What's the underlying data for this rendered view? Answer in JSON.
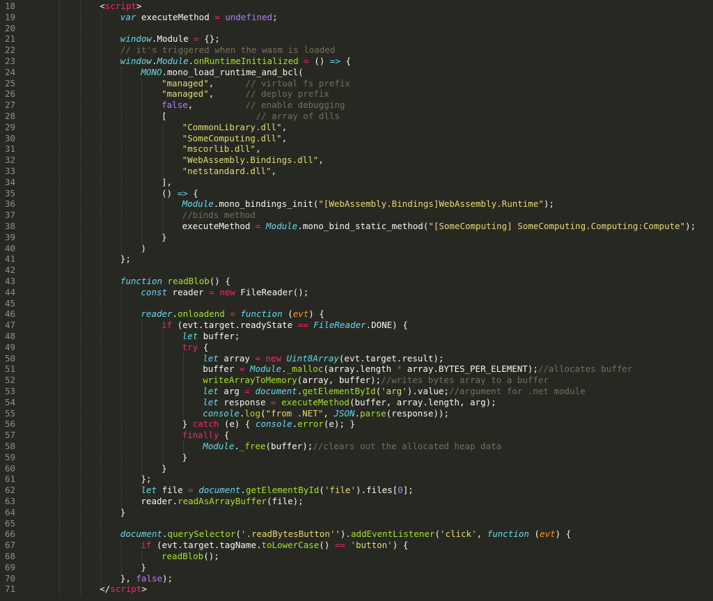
{
  "editor": {
    "theme": "monokai",
    "colors": {
      "background": "#272822",
      "foreground": "#f8f8f2",
      "line_number": "#90908a",
      "keyword": "#f92672",
      "string": "#e6db74",
      "comment": "#75715e",
      "constant": "#ae81ff",
      "function": "#a6e22e",
      "storage": "#66d9ef",
      "parameter": "#fd971f"
    },
    "lines": [
      {
        "num": "18",
        "indent": 2,
        "tokens": [
          [
            "t",
            "<"
          ],
          [
            "k",
            "script"
          ],
          [
            "t",
            ">"
          ]
        ]
      },
      {
        "num": "19",
        "indent": 3,
        "tokens": [
          [
            "i",
            "var"
          ],
          [
            "t",
            " executeMethod "
          ],
          [
            "k",
            "="
          ],
          [
            "t",
            " "
          ],
          [
            "n",
            "undefined"
          ],
          [
            "t",
            ";"
          ]
        ]
      },
      {
        "num": "20",
        "indent": 0,
        "tokens": []
      },
      {
        "num": "21",
        "indent": 3,
        "tokens": [
          [
            "i",
            "window"
          ],
          [
            "t",
            ".Module "
          ],
          [
            "k",
            "="
          ],
          [
            "t",
            " {};"
          ]
        ]
      },
      {
        "num": "22",
        "indent": 3,
        "tokens": [
          [
            "c",
            "// it's triggered when the wasm is loaded"
          ]
        ]
      },
      {
        "num": "23",
        "indent": 3,
        "tokens": [
          [
            "i",
            "window"
          ],
          [
            "t",
            "."
          ],
          [
            "i",
            "Module"
          ],
          [
            "t",
            "."
          ],
          [
            "f",
            "onRuntimeInitialized"
          ],
          [
            "t",
            " "
          ],
          [
            "k",
            "="
          ],
          [
            "t",
            " () "
          ],
          [
            "i",
            "=>"
          ],
          [
            "t",
            " {"
          ]
        ]
      },
      {
        "num": "24",
        "indent": 4,
        "tokens": [
          [
            "i",
            "MONO"
          ],
          [
            "t",
            ".mono_load_runtime_and_bcl("
          ]
        ]
      },
      {
        "num": "25",
        "indent": 5,
        "tokens": [
          [
            "s",
            "\"managed\""
          ],
          [
            "t",
            ",      "
          ],
          [
            "c",
            "// virtual fs prefix"
          ]
        ]
      },
      {
        "num": "26",
        "indent": 5,
        "tokens": [
          [
            "s",
            "\"managed\""
          ],
          [
            "t",
            ",      "
          ],
          [
            "c",
            "// deploy prefix"
          ]
        ]
      },
      {
        "num": "27",
        "indent": 5,
        "tokens": [
          [
            "n",
            "false"
          ],
          [
            "t",
            ",          "
          ],
          [
            "c",
            "// enable debugging"
          ]
        ]
      },
      {
        "num": "28",
        "indent": 5,
        "tokens": [
          [
            "t",
            "[                 "
          ],
          [
            "c",
            "// array of dlls"
          ]
        ]
      },
      {
        "num": "29",
        "indent": 6,
        "tokens": [
          [
            "s",
            "\"CommonLibrary.dll\""
          ],
          [
            "t",
            ","
          ]
        ]
      },
      {
        "num": "30",
        "indent": 6,
        "tokens": [
          [
            "s",
            "\"SomeComputing.dll\""
          ],
          [
            "t",
            ","
          ]
        ]
      },
      {
        "num": "31",
        "indent": 6,
        "tokens": [
          [
            "s",
            "\"mscorlib.dll\""
          ],
          [
            "t",
            ","
          ]
        ]
      },
      {
        "num": "32",
        "indent": 6,
        "tokens": [
          [
            "s",
            "\"WebAssembly.Bindings.dll\""
          ],
          [
            "t",
            ","
          ]
        ]
      },
      {
        "num": "33",
        "indent": 6,
        "tokens": [
          [
            "s",
            "\"netstandard.dll\""
          ],
          [
            "t",
            ","
          ]
        ]
      },
      {
        "num": "34",
        "indent": 5,
        "tokens": [
          [
            "t",
            "],"
          ]
        ]
      },
      {
        "num": "35",
        "indent": 5,
        "tokens": [
          [
            "t",
            "() "
          ],
          [
            "i",
            "=>"
          ],
          [
            "t",
            " {"
          ]
        ]
      },
      {
        "num": "36",
        "indent": 6,
        "tokens": [
          [
            "i",
            "Module"
          ],
          [
            "t",
            ".mono_bindings_init("
          ],
          [
            "s",
            "\"[WebAssembly.Bindings]WebAssembly.Runtime\""
          ],
          [
            "t",
            ");"
          ]
        ]
      },
      {
        "num": "37",
        "indent": 6,
        "tokens": [
          [
            "c",
            "//binds method"
          ]
        ]
      },
      {
        "num": "38",
        "indent": 6,
        "tokens": [
          [
            "t",
            "executeMethod "
          ],
          [
            "k",
            "="
          ],
          [
            "t",
            " "
          ],
          [
            "i",
            "Module"
          ],
          [
            "t",
            ".mono_bind_static_method("
          ],
          [
            "s",
            "\"[SomeComputing] SomeComputing.Computing:Compute\""
          ],
          [
            "t",
            ");"
          ]
        ]
      },
      {
        "num": "39",
        "indent": 5,
        "tokens": [
          [
            "t",
            "}"
          ]
        ]
      },
      {
        "num": "40",
        "indent": 4,
        "tokens": [
          [
            "t",
            ")"
          ]
        ]
      },
      {
        "num": "41",
        "indent": 3,
        "tokens": [
          [
            "t",
            "};"
          ]
        ]
      },
      {
        "num": "42",
        "indent": 0,
        "tokens": []
      },
      {
        "num": "43",
        "indent": 3,
        "tokens": [
          [
            "i",
            "function"
          ],
          [
            "t",
            " "
          ],
          [
            "f",
            "readBlob"
          ],
          [
            "t",
            "() {"
          ]
        ]
      },
      {
        "num": "44",
        "indent": 4,
        "tokens": [
          [
            "i",
            "const"
          ],
          [
            "t",
            " reader "
          ],
          [
            "k",
            "="
          ],
          [
            "t",
            " "
          ],
          [
            "k",
            "new"
          ],
          [
            "t",
            " FileReader();"
          ]
        ]
      },
      {
        "num": "45",
        "indent": 0,
        "tokens": []
      },
      {
        "num": "46",
        "indent": 4,
        "tokens": [
          [
            "i",
            "reader"
          ],
          [
            "t",
            "."
          ],
          [
            "f",
            "onloadend"
          ],
          [
            "t",
            " "
          ],
          [
            "k",
            "="
          ],
          [
            "t",
            " "
          ],
          [
            "i",
            "function"
          ],
          [
            "t",
            " ("
          ],
          [
            "p",
            "evt"
          ],
          [
            "t",
            ") {"
          ]
        ]
      },
      {
        "num": "47",
        "indent": 5,
        "tokens": [
          [
            "k",
            "if"
          ],
          [
            "t",
            " (evt.target.readyState "
          ],
          [
            "k",
            "=="
          ],
          [
            "t",
            " "
          ],
          [
            "i",
            "FileReader"
          ],
          [
            "t",
            ".DONE) {"
          ]
        ]
      },
      {
        "num": "48",
        "indent": 6,
        "tokens": [
          [
            "i",
            "let"
          ],
          [
            "t",
            " buffer;"
          ]
        ]
      },
      {
        "num": "49",
        "indent": 6,
        "tokens": [
          [
            "k",
            "try"
          ],
          [
            "t",
            " {"
          ]
        ]
      },
      {
        "num": "50",
        "indent": 7,
        "tokens": [
          [
            "i",
            "let"
          ],
          [
            "t",
            " array "
          ],
          [
            "k",
            "="
          ],
          [
            "t",
            " "
          ],
          [
            "k",
            "new"
          ],
          [
            "t",
            " "
          ],
          [
            "i",
            "Uint8Array"
          ],
          [
            "t",
            "(evt.target.result);"
          ]
        ]
      },
      {
        "num": "51",
        "indent": 7,
        "tokens": [
          [
            "t",
            "buffer "
          ],
          [
            "k",
            "="
          ],
          [
            "t",
            " "
          ],
          [
            "i",
            "Module"
          ],
          [
            "t",
            "."
          ],
          [
            "f",
            "_malloc"
          ],
          [
            "t",
            "(array.length "
          ],
          [
            "k",
            "*"
          ],
          [
            "t",
            " array.BYTES_PER_ELEMENT);"
          ],
          [
            "c",
            "//allocates buffer"
          ]
        ]
      },
      {
        "num": "52",
        "indent": 7,
        "tokens": [
          [
            "f",
            "writeArrayToMemory"
          ],
          [
            "t",
            "(array, buffer);"
          ],
          [
            "c",
            "//writes bytes array to a buffer"
          ]
        ]
      },
      {
        "num": "53",
        "indent": 7,
        "tokens": [
          [
            "i",
            "let"
          ],
          [
            "t",
            " arg "
          ],
          [
            "k",
            "="
          ],
          [
            "t",
            " "
          ],
          [
            "i",
            "document"
          ],
          [
            "t",
            "."
          ],
          [
            "f",
            "getElementById"
          ],
          [
            "t",
            "("
          ],
          [
            "s",
            "'arg'"
          ],
          [
            "t",
            ").value;"
          ],
          [
            "c",
            "//argument for .net module"
          ]
        ]
      },
      {
        "num": "54",
        "indent": 7,
        "tokens": [
          [
            "i",
            "let"
          ],
          [
            "t",
            " response "
          ],
          [
            "k",
            "="
          ],
          [
            "t",
            " "
          ],
          [
            "f",
            "executeMethod"
          ],
          [
            "t",
            "(buffer, array.length, arg);"
          ]
        ]
      },
      {
        "num": "55",
        "indent": 7,
        "tokens": [
          [
            "i",
            "console"
          ],
          [
            "t",
            "."
          ],
          [
            "f",
            "log"
          ],
          [
            "t",
            "("
          ],
          [
            "s",
            "\"from .NET\""
          ],
          [
            "t",
            ", "
          ],
          [
            "i",
            "JSON"
          ],
          [
            "t",
            "."
          ],
          [
            "f",
            "parse"
          ],
          [
            "t",
            "(response));"
          ]
        ]
      },
      {
        "num": "56",
        "indent": 6,
        "tokens": [
          [
            "t",
            "} "
          ],
          [
            "k",
            "catch"
          ],
          [
            "t",
            " (e) { "
          ],
          [
            "i",
            "console"
          ],
          [
            "t",
            "."
          ],
          [
            "f",
            "error"
          ],
          [
            "t",
            "(e); }"
          ]
        ]
      },
      {
        "num": "57",
        "indent": 6,
        "tokens": [
          [
            "k",
            "finally"
          ],
          [
            "t",
            " {"
          ]
        ]
      },
      {
        "num": "58",
        "indent": 7,
        "tokens": [
          [
            "i",
            "Module"
          ],
          [
            "t",
            "."
          ],
          [
            "f",
            "_free"
          ],
          [
            "t",
            "(buffer);"
          ],
          [
            "c",
            "//clears out the allocated heap data"
          ]
        ]
      },
      {
        "num": "59",
        "indent": 6,
        "tokens": [
          [
            "t",
            "}"
          ]
        ]
      },
      {
        "num": "60",
        "indent": 5,
        "tokens": [
          [
            "t",
            "}"
          ]
        ]
      },
      {
        "num": "61",
        "indent": 4,
        "tokens": [
          [
            "t",
            "};"
          ]
        ]
      },
      {
        "num": "62",
        "indent": 4,
        "tokens": [
          [
            "i",
            "let"
          ],
          [
            "t",
            " file "
          ],
          [
            "k",
            "="
          ],
          [
            "t",
            " "
          ],
          [
            "i",
            "document"
          ],
          [
            "t",
            "."
          ],
          [
            "f",
            "getElementById"
          ],
          [
            "t",
            "("
          ],
          [
            "s",
            "'file'"
          ],
          [
            "t",
            ").files["
          ],
          [
            "n",
            "0"
          ],
          [
            "t",
            "];"
          ]
        ]
      },
      {
        "num": "63",
        "indent": 4,
        "tokens": [
          [
            "t",
            "reader."
          ],
          [
            "f",
            "readAsArrayBuffer"
          ],
          [
            "t",
            "(file);"
          ]
        ]
      },
      {
        "num": "64",
        "indent": 3,
        "tokens": [
          [
            "t",
            "}"
          ]
        ]
      },
      {
        "num": "65",
        "indent": 0,
        "tokens": []
      },
      {
        "num": "66",
        "indent": 3,
        "tokens": [
          [
            "i",
            "document"
          ],
          [
            "t",
            "."
          ],
          [
            "f",
            "querySelector"
          ],
          [
            "t",
            "("
          ],
          [
            "s",
            "'.readBytesButton'"
          ],
          [
            "t",
            "')."
          ],
          [
            "f",
            "addEventListener"
          ],
          [
            "t",
            "("
          ],
          [
            "s",
            "'click'"
          ],
          [
            "t",
            ", "
          ],
          [
            "i",
            "function"
          ],
          [
            "t",
            " ("
          ],
          [
            "p",
            "evt"
          ],
          [
            "t",
            ") {"
          ]
        ]
      },
      {
        "num": "67",
        "indent": 4,
        "tokens": [
          [
            "k",
            "if"
          ],
          [
            "t",
            " (evt.target.tagName."
          ],
          [
            "f",
            "toLowerCase"
          ],
          [
            "t",
            "() "
          ],
          [
            "k",
            "=="
          ],
          [
            "t",
            " "
          ],
          [
            "s",
            "'button'"
          ],
          [
            "t",
            ") {"
          ]
        ]
      },
      {
        "num": "68",
        "indent": 5,
        "tokens": [
          [
            "f",
            "readBlob"
          ],
          [
            "t",
            "();"
          ]
        ]
      },
      {
        "num": "69",
        "indent": 4,
        "tokens": [
          [
            "t",
            "}"
          ]
        ]
      },
      {
        "num": "70",
        "indent": 3,
        "tokens": [
          [
            "t",
            "}, "
          ],
          [
            "n",
            "false"
          ],
          [
            "t",
            ");"
          ]
        ]
      },
      {
        "num": "71",
        "indent": 2,
        "tokens": [
          [
            "t",
            "</"
          ],
          [
            "k",
            "script"
          ],
          [
            "t",
            ">"
          ]
        ]
      }
    ]
  }
}
